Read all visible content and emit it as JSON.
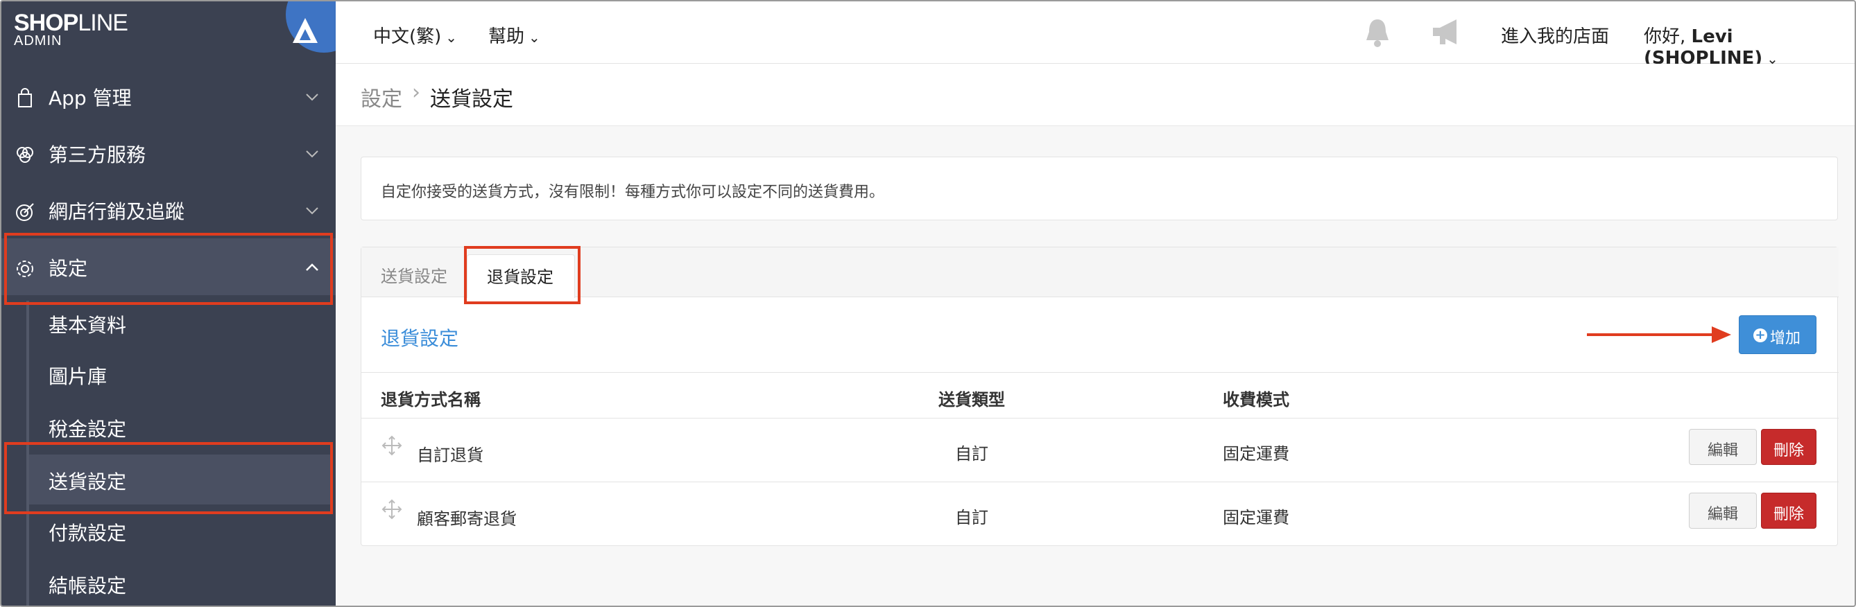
{
  "brand": {
    "logo_text_bold": "SHOP",
    "logo_text_light": "LINE",
    "logo_sub": "ADMIN",
    "accent": "#3e74c4"
  },
  "sidebar": {
    "background": "#3b4151",
    "items": [
      {
        "label": "App 管理",
        "icon": "shopping-bag-icon"
      },
      {
        "label": "第三方服務",
        "icon": "circles-icon"
      },
      {
        "label": "網店行銷及追蹤",
        "icon": "target-icon"
      },
      {
        "label": "設定",
        "icon": "gear-icon"
      }
    ],
    "sub_items": [
      {
        "label": "基本資料"
      },
      {
        "label": "圖片庫"
      },
      {
        "label": "稅金設定"
      },
      {
        "label": "送貨設定"
      },
      {
        "label": "付款設定"
      },
      {
        "label": "結帳設定"
      }
    ]
  },
  "topbar": {
    "language": "中文(繁)",
    "help": "幫助",
    "enter_store": "進入我的店面",
    "greeting": "你好, ",
    "user": "Levi (SHOPLINE)",
    "icons": [
      "bell-icon",
      "megaphone-icon"
    ]
  },
  "breadcrumb": {
    "parent": "設定",
    "separator": "›",
    "current": "送貨設定"
  },
  "info": {
    "text": "自定你接受的送貨方式，沒有限制！每種方式你可以設定不同的送貨費用。"
  },
  "tabs": [
    {
      "label": "送貨設定"
    },
    {
      "label": "退貨設定"
    }
  ],
  "section": {
    "title": "退貨設定",
    "add_label": "增加"
  },
  "table": {
    "headers": [
      "退貨方式名稱",
      "送貨類型",
      "收費模式"
    ],
    "rows": [
      {
        "name": "自訂退貨",
        "type": "自訂",
        "fee_mode": "固定運費",
        "edit": "編輯",
        "delete": "刪除"
      },
      {
        "name": "顧客郵寄退貨",
        "type": "自訂",
        "fee_mode": "固定運費",
        "edit": "編輯",
        "delete": "刪除"
      }
    ]
  },
  "colors": {
    "highlight": "#e03c1f",
    "link": "#3b8dd9",
    "add_button": "#3f8fd8",
    "delete_button": "#c62b2b"
  }
}
